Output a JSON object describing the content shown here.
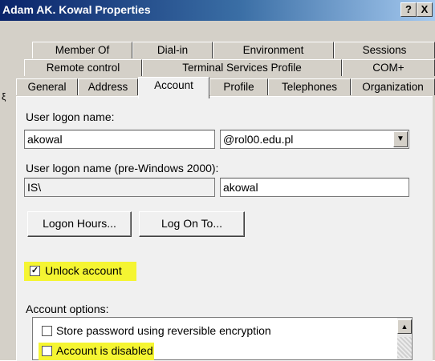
{
  "window": {
    "title": "Adam AK. Kowal Properties",
    "help_label": "?",
    "close_label": "X"
  },
  "tabs": {
    "row1": [
      "Member Of",
      "Dial-in",
      "Environment",
      "Sessions"
    ],
    "row2": [
      "Remote control",
      "Terminal Services Profile",
      "COM+"
    ],
    "row3": [
      "General",
      "Address",
      "Account",
      "Profile",
      "Telephones",
      "Organization"
    ],
    "active": "Account"
  },
  "stray_glyph": "ξ",
  "account": {
    "logon_name_label": "User logon name:",
    "logon_name_value": "akowal",
    "domain_value": "@rol00.edu.pl",
    "pre2000_label": "User logon name (pre-Windows 2000):",
    "pre2000_domain": "IS\\",
    "pre2000_user": "akowal",
    "logon_hours_button": "Logon Hours...",
    "log_on_to_button": "Log On To...",
    "unlock_label": "Unlock account",
    "unlock_checked": true,
    "options_label": "Account options:",
    "options": [
      {
        "label": "Store password using reversible encryption",
        "checked": false
      },
      {
        "label": "Account is disabled",
        "checked": false
      }
    ],
    "highlight_color": "#f5f532"
  }
}
